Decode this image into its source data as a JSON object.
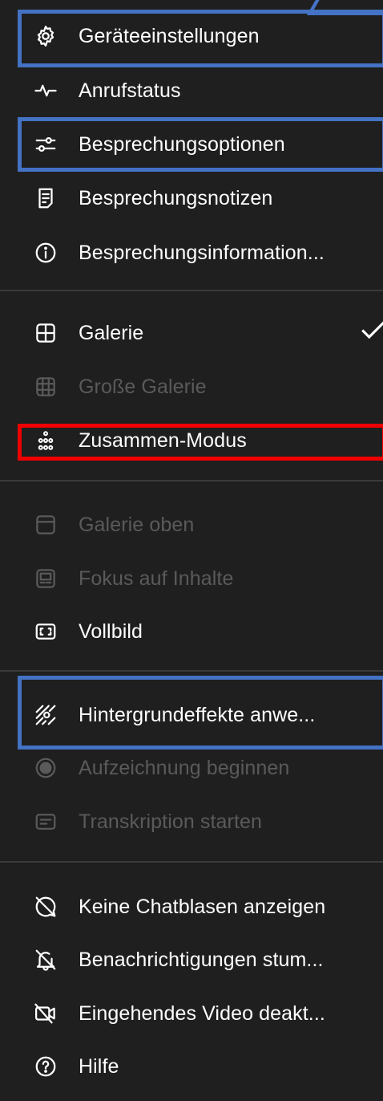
{
  "menu": {
    "items": [
      {
        "label": "Geräteeinstellungen",
        "icon": "gear-icon",
        "disabled": false
      },
      {
        "label": "Anrufstatus",
        "icon": "pulse-icon",
        "disabled": false
      },
      {
        "label": "Besprechungsoptionen",
        "icon": "sliders-icon",
        "disabled": false
      },
      {
        "label": "Besprechungsnotizen",
        "icon": "notes-icon",
        "disabled": false
      },
      {
        "label": "Besprechungsinformation...",
        "icon": "info-icon",
        "disabled": false
      },
      {
        "label": "Galerie",
        "icon": "gallery-icon",
        "disabled": false,
        "checked": true
      },
      {
        "label": "Große Galerie",
        "icon": "large-gallery-icon",
        "disabled": true
      },
      {
        "label": "Zusammen-Modus",
        "icon": "together-mode-icon",
        "disabled": false
      },
      {
        "label": "Galerie oben",
        "icon": "gallery-top-icon",
        "disabled": true
      },
      {
        "label": "Fokus auf Inhalte",
        "icon": "focus-icon",
        "disabled": true
      },
      {
        "label": "Vollbild",
        "icon": "fullscreen-icon",
        "disabled": false
      },
      {
        "label": "Hintergrundeffekte anwe...",
        "icon": "background-effects-icon",
        "disabled": false
      },
      {
        "label": "Aufzeichnung beginnen",
        "icon": "record-icon",
        "disabled": true
      },
      {
        "label": "Transkription starten",
        "icon": "transcript-icon",
        "disabled": true
      },
      {
        "label": "Keine Chatblasen anzeigen",
        "icon": "chat-bubble-off-icon",
        "disabled": false
      },
      {
        "label": "Benachrichtigungen stum...",
        "icon": "bell-off-icon",
        "disabled": false
      },
      {
        "label": "Eingehendes Video deakt...",
        "icon": "video-off-icon",
        "disabled": false
      },
      {
        "label": "Hilfe",
        "icon": "help-icon",
        "disabled": false
      }
    ]
  },
  "colors": {
    "background": "#1f1f1f",
    "text": "#ffffff",
    "disabled_text": "#5a5a5a",
    "separator": "#3a3a3a",
    "highlight_blue": "#4472c4",
    "highlight_red": "#ee0000"
  }
}
